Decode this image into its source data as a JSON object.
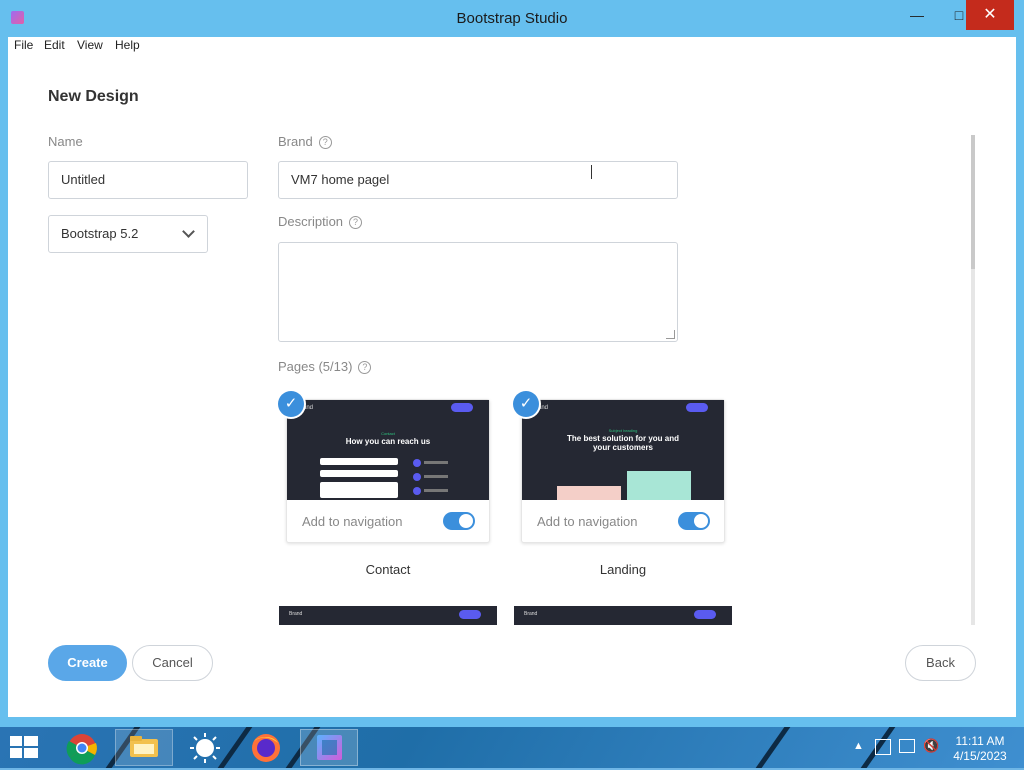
{
  "window": {
    "title": "Bootstrap Studio",
    "minimize_glyph": "—",
    "maximize_glyph": "□",
    "close_glyph": "✕"
  },
  "menu": {
    "items": [
      "File",
      "Edit",
      "View",
      "Help"
    ]
  },
  "dialog": {
    "title": "New Design",
    "name_label": "Name",
    "name_value": "Untitled",
    "version_value": "Bootstrap 5.2",
    "brand_label": "Brand",
    "brand_value": "VM7 home pagel",
    "description_label": "Description",
    "description_value": "",
    "pages_label": "Pages (5/13)",
    "help_glyph": "?",
    "pages": [
      {
        "name": "Contact",
        "selected": true,
        "nav_label": "Add to navigation",
        "nav_on": true,
        "thumb": {
          "brand": "Brand",
          "eyebrow": "Contact",
          "headline": "How you can reach us"
        }
      },
      {
        "name": "Landing",
        "selected": true,
        "nav_label": "Add to navigation",
        "nav_on": true,
        "thumb": {
          "brand": "Brand",
          "eyebrow": "Subject heading",
          "headline": "The best solution for you and your customers"
        }
      }
    ],
    "partial_pages": [
      {
        "brand": "Brand"
      },
      {
        "brand": "Brand"
      }
    ],
    "check_glyph": "✓",
    "buttons": {
      "create": "Create",
      "cancel": "Cancel",
      "back": "Back"
    }
  },
  "taskbar": {
    "apps": [
      "start-button",
      "chrome-icon",
      "file-explorer-icon",
      "weather-icon",
      "firefox-icon",
      "bootstrap-studio-icon"
    ],
    "clock_time": "11:11 AM",
    "clock_date": "4/15/2023",
    "tray_arrow": "▲"
  },
  "colors": {
    "titlebar": "#66bfee",
    "accent": "#3b8fdc",
    "primary_button": "#5aa7e8",
    "close_button": "#c42b1c"
  }
}
